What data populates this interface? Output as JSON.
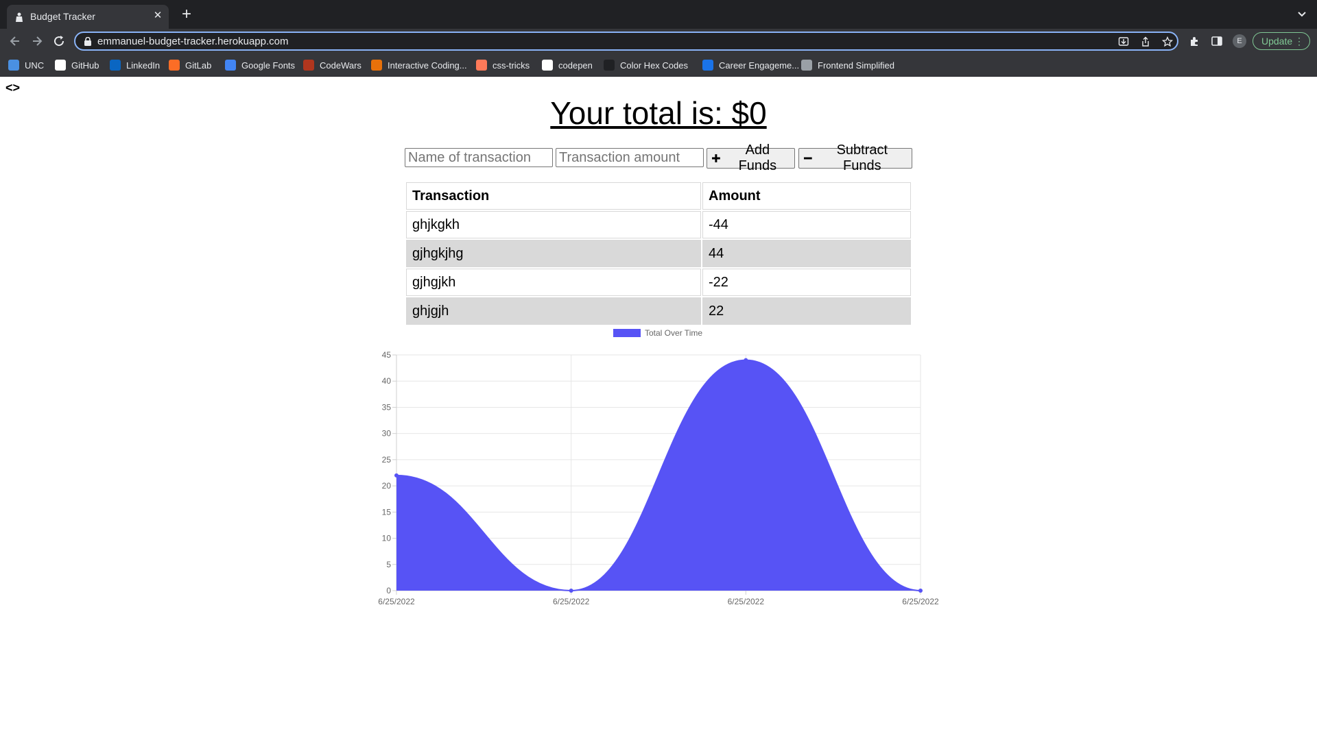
{
  "browser": {
    "tab_title": "Budget Tracker",
    "url": "emmanuel-budget-tracker.herokuapp.com",
    "avatar_letter": "E",
    "update_label": "Update",
    "bookmarks": [
      {
        "label": "UNC",
        "icon": "unc-icon",
        "color": "#4a90e2"
      },
      {
        "label": "GitHub",
        "icon": "github-icon",
        "color": "#ffffff"
      },
      {
        "label": "LinkedIn",
        "icon": "linkedin-icon",
        "color": "#0a66c2"
      },
      {
        "label": "GitLab",
        "icon": "gitlab-icon",
        "color": "#fc6d26"
      },
      {
        "label": "Google Fonts",
        "icon": "google-fonts-icon",
        "color": "#4285f4"
      },
      {
        "label": "CodeWars",
        "icon": "codewars-icon",
        "color": "#b1361e"
      },
      {
        "label": "Interactive Coding...",
        "icon": "interactive-coding-icon",
        "color": "#e8710a"
      },
      {
        "label": "css-tricks",
        "icon": "css-tricks-icon",
        "color": "#ff7a59"
      },
      {
        "label": "codepen",
        "icon": "codepen-icon",
        "color": "#ffffff"
      },
      {
        "label": "Color Hex Codes",
        "icon": "color-hex-icon",
        "color": "#202124"
      },
      {
        "label": "Career Engageme...",
        "icon": "career-icon",
        "color": "#1a73e8"
      },
      {
        "label": "Frontend Simplified",
        "icon": "frontend-simplified-icon",
        "color": "#9aa0a6"
      }
    ]
  },
  "page": {
    "brand": "<>",
    "total_text": "Your total is: $0",
    "name_placeholder": "Name of transaction",
    "amount_placeholder": "Transaction amount",
    "add_label": "Add Funds",
    "subtract_label": "Subtract Funds",
    "table": {
      "headers": [
        "Transaction",
        "Amount"
      ],
      "rows": [
        {
          "name": "ghjkgkh",
          "amount": "-44"
        },
        {
          "name": "gjhgkjhg",
          "amount": "44"
        },
        {
          "name": "gjhgjkh",
          "amount": "-22"
        },
        {
          "name": "ghjgjh",
          "amount": "22"
        }
      ]
    }
  },
  "chart_data": {
    "type": "area",
    "x": [
      "6/25/2022",
      "6/25/2022",
      "6/25/2022",
      "6/25/2022"
    ],
    "series": [
      {
        "name": "Total Over Time",
        "values": [
          22,
          0,
          44,
          0
        ],
        "color": "#5753f5"
      }
    ],
    "ylim": [
      0,
      45
    ],
    "yticks": [
      0,
      5,
      10,
      15,
      20,
      25,
      30,
      35,
      40,
      45
    ],
    "grid": true,
    "legend_position": "top"
  }
}
